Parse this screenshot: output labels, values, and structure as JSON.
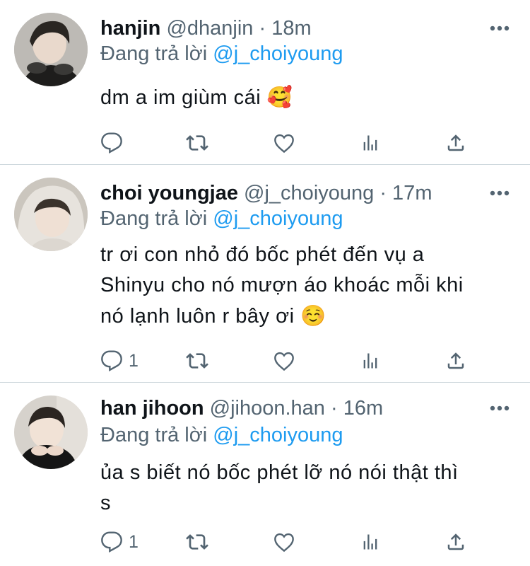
{
  "tweets": [
    {
      "name": "hanjin",
      "handle": "@dhanjin",
      "time": "· 18m",
      "reply_prefix": "Đang trả lời",
      "reply_to": "@j_choiyoung",
      "text": "dm a im giùm cái",
      "emoji": "🥰",
      "reply_count": "",
      "avatar_icon": "person-headphones-avatar"
    },
    {
      "name": "choi youngjae",
      "handle": "@j_choiyoung",
      "time": "· 17m",
      "reply_prefix": "Đang trả lời",
      "reply_to": "@j_choiyoung",
      "text_lines": [
        "tr ơi con nhỏ đó bốc phét đến vụ a",
        "Shinyu cho nó mượn áo khoác mỗi khi",
        "nó lạnh luôn r bây ơi"
      ],
      "emoji": "☺️",
      "reply_count": "1",
      "avatar_icon": "person-blanket-avatar"
    },
    {
      "name": "han jihoon",
      "handle": "@jihoon.han",
      "time": "· 16m",
      "reply_prefix": "Đang trả lời",
      "reply_to": "@j_choiyoung",
      "text_lines": [
        "ủa s biết nó bốc phét lỡ nó nói thật thì",
        "s"
      ],
      "reply_count": "1",
      "avatar_icon": "person-hoodie-avatar"
    }
  ],
  "colors": {
    "text": "#0f1419",
    "muted": "#536471",
    "link": "#1d9bf0",
    "divider": "#cfd9de"
  },
  "icons": [
    "more-icon",
    "reply-icon",
    "retweet-icon",
    "like-icon",
    "views-icon",
    "share-icon"
  ]
}
